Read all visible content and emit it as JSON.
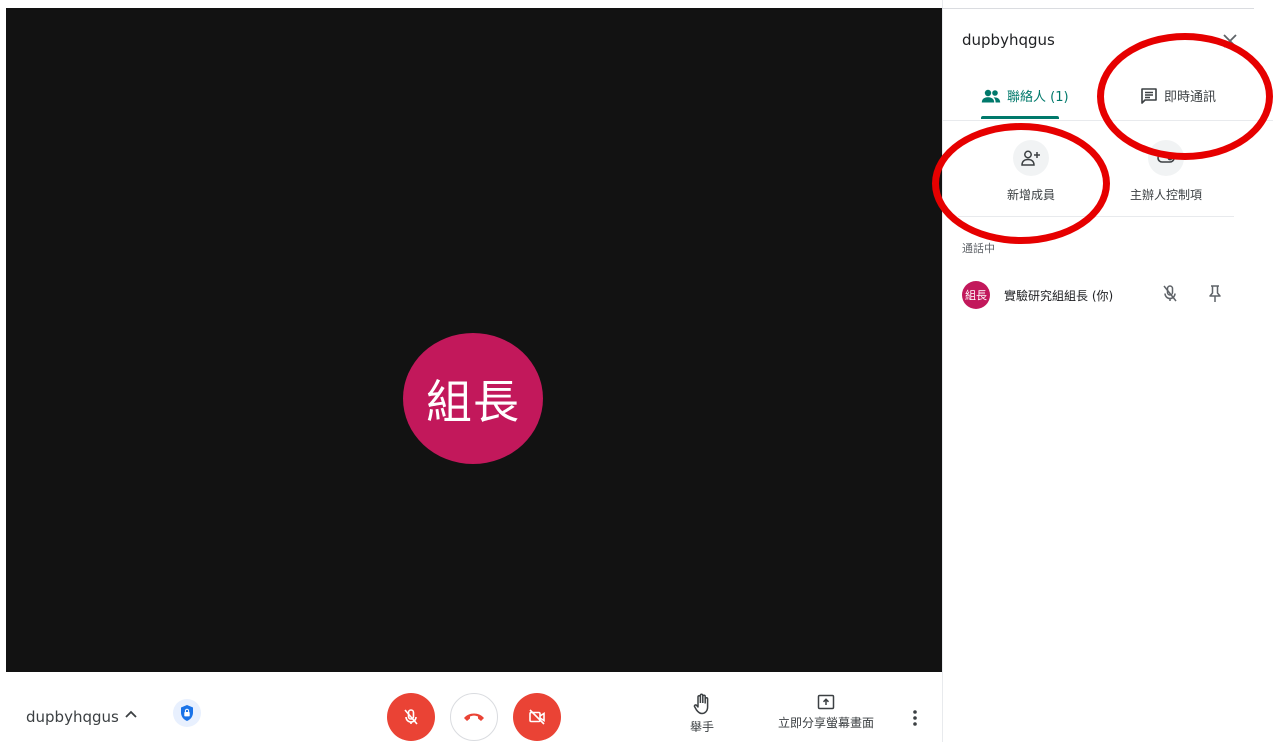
{
  "meeting": {
    "code": "dupbyhqgus"
  },
  "stage": {
    "avatar_text": "組長",
    "avatar_color": "#c2185b"
  },
  "controls": {
    "raise_hand_label": "舉手",
    "share_screen_label": "立即分享螢幕畫面",
    "mic_state": "muted",
    "camera_state": "off",
    "danger_color": "#ea4335"
  },
  "panel": {
    "title": "dupbyhqgus",
    "tabs": [
      {
        "label": "聯絡人 (1)",
        "icon": "people-icon",
        "active": true
      },
      {
        "label": "即時通訊",
        "icon": "chat-icon",
        "active": false
      }
    ],
    "actions": [
      {
        "label": "新增成員",
        "icon": "person-add-icon"
      },
      {
        "label": "主辦人控制項",
        "icon": "host-controls-icon"
      }
    ],
    "section_label": "通話中",
    "participants": [
      {
        "avatar_text": "組長",
        "name": "實驗研究組組長 (你)",
        "muted": true
      }
    ],
    "accent_color": "#00796b"
  },
  "annotations": {
    "color": "#e60000",
    "highlighted": [
      "新增成員",
      "即時通訊"
    ]
  }
}
